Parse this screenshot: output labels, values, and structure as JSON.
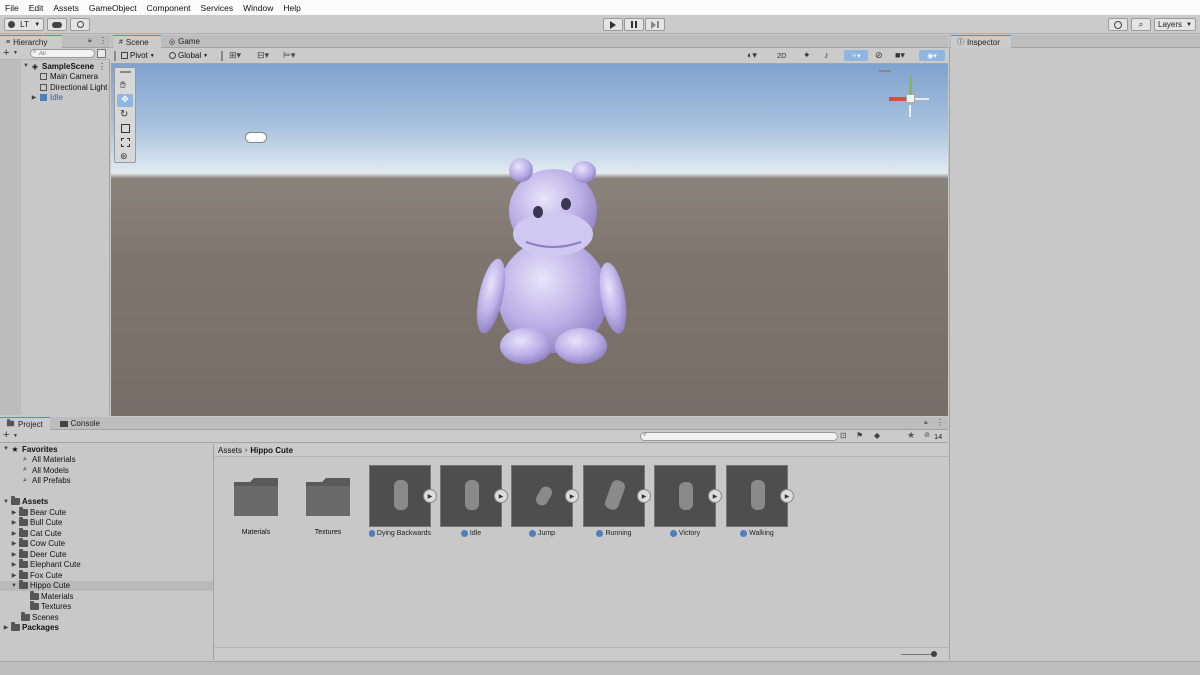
{
  "menu": [
    "File",
    "Edit",
    "Assets",
    "GameObject",
    "Component",
    "Services",
    "Window",
    "Help"
  ],
  "toolbar": {
    "account": "LT",
    "layers": "Layers"
  },
  "hierarchy": {
    "tab": "Hierarchy",
    "search_placeholder": "All",
    "scene": "SampleScene",
    "items": [
      "Main Camera",
      "Directional Light",
      "Idle"
    ]
  },
  "scene_tabs": {
    "scene": "Scene",
    "game": "Game",
    "pivot": "Pivot",
    "global": "Global",
    "two_d": "2D"
  },
  "inspector": {
    "tab": "Inspector"
  },
  "project": {
    "tabs": [
      "Project",
      "Console"
    ],
    "item_count": "14",
    "breadcrumb_root": "Assets",
    "breadcrumb_current": "Hippo Cute",
    "favorites_label": "Favorites",
    "favorites": [
      "All Materials",
      "All Models",
      "All Prefabs"
    ],
    "assets_label": "Assets",
    "asset_folders": [
      "Bear Cute",
      "Bull Cute",
      "Cat Cute",
      "Cow Cute",
      "Deer Cute",
      "Elephant Cute",
      "Fox Cute",
      "Hippo Cute"
    ],
    "hippo_children": [
      "Materials",
      "Textures"
    ],
    "scenes_label": "Scenes",
    "packages_label": "Packages",
    "grid_folders": [
      "Materials",
      "Textures"
    ],
    "grid_assets": [
      "Dying Backwards",
      "Idle",
      "Jump",
      "Running",
      "Victory",
      "Walking"
    ]
  },
  "colors": {
    "accent": "#4a90d9",
    "selected_row": "#b9b9b9",
    "hippo": "#b9aee6"
  }
}
